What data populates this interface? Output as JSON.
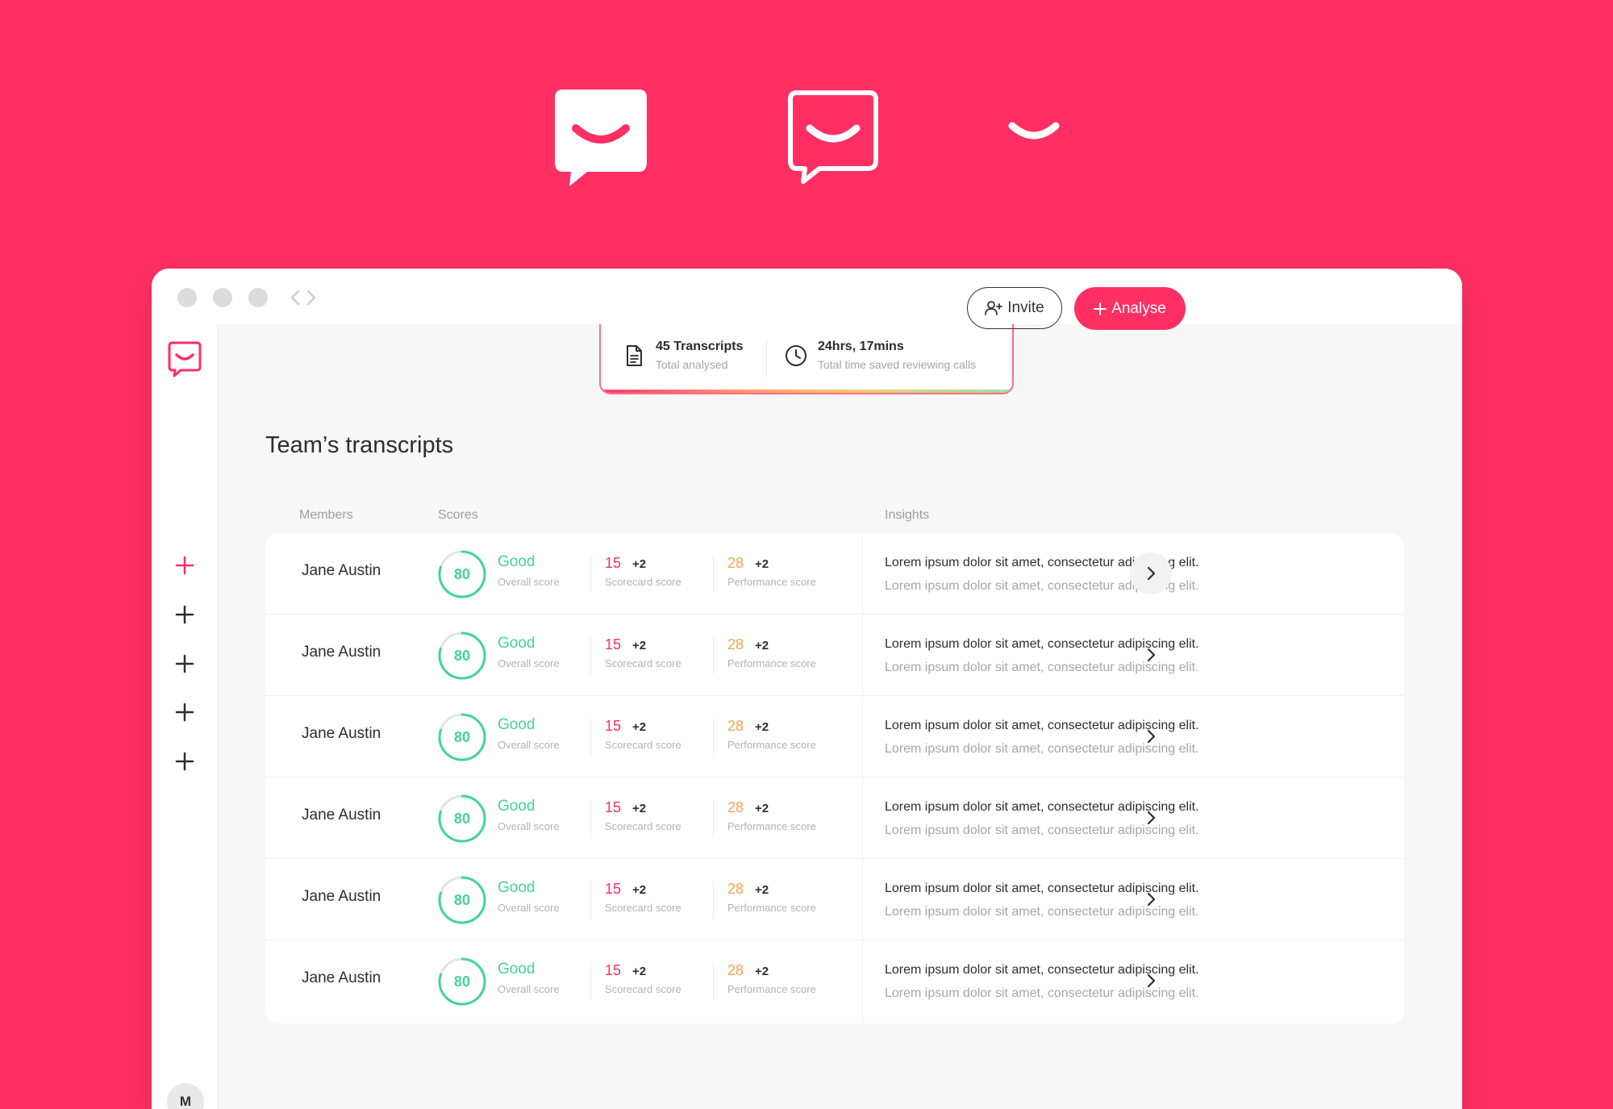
{
  "colors": {
    "brand": "#FF2F63",
    "good": "#43D49A",
    "orange": "#F7A34B",
    "text": "#2D2D2D",
    "muted": "#A6A6A6"
  },
  "logo_variations": [
    {
      "name": "filled-speech-bubble-logo"
    },
    {
      "name": "outline-speech-bubble-logo"
    },
    {
      "name": "smile-mark-logo"
    }
  ],
  "sidebar": {
    "items": [
      {
        "icon": "plus-icon",
        "active": true
      },
      {
        "icon": "plus-icon",
        "active": false
      },
      {
        "icon": "plus-icon",
        "active": false
      },
      {
        "icon": "plus-icon",
        "active": false
      },
      {
        "icon": "plus-icon",
        "active": false
      }
    ],
    "avatar_initial": "M"
  },
  "stats": {
    "transcripts": {
      "title": "45 Transcripts",
      "subtitle": "Total analysed",
      "icon": "document-icon"
    },
    "time_saved": {
      "title": "24hrs, 17mins",
      "subtitle": "Total time saved reviewing calls",
      "icon": "clock-icon"
    }
  },
  "actions": {
    "invite_label": "Invite",
    "analyse_label": "Analyse"
  },
  "page_title": "Team’s transcripts",
  "columns": {
    "members": "Members",
    "scores": "Scores",
    "insights": "Insights"
  },
  "rows": [
    {
      "member": "Jane Austin",
      "overall_value": "80",
      "overall_fraction": 0.8,
      "overall_label": "Good",
      "overall_sub": "Overall score",
      "scorecard_value": "15",
      "scorecard_delta": "+2",
      "scorecard_sub": "Scorecard score",
      "performance_value": "28",
      "performance_delta": "+2",
      "performance_sub": "Performance score",
      "insight_1": "Lorem ipsum dolor sit amet, consectetur adipiscing elit.",
      "insight_2": "Lorem ipsum dolor sit amet, consectetur adipiscing elit."
    },
    {
      "member": "Jane Austin",
      "overall_value": "80",
      "overall_fraction": 0.8,
      "overall_label": "Good",
      "overall_sub": "Overall score",
      "scorecard_value": "15",
      "scorecard_delta": "+2",
      "scorecard_sub": "Scorecard score",
      "performance_value": "28",
      "performance_delta": "+2",
      "performance_sub": "Performance score",
      "insight_1": "Lorem ipsum dolor sit amet, consectetur adipiscing elit.",
      "insight_2": "Lorem ipsum dolor sit amet, consectetur adipiscing elit."
    },
    {
      "member": "Jane Austin",
      "overall_value": "80",
      "overall_fraction": 0.8,
      "overall_label": "Good",
      "overall_sub": "Overall score",
      "scorecard_value": "15",
      "scorecard_delta": "+2",
      "scorecard_sub": "Scorecard score",
      "performance_value": "28",
      "performance_delta": "+2",
      "performance_sub": "Performance score",
      "insight_1": "Lorem ipsum dolor sit amet, consectetur adipiscing elit.",
      "insight_2": "Lorem ipsum dolor sit amet, consectetur adipiscing elit."
    },
    {
      "member": "Jane Austin",
      "overall_value": "80",
      "overall_fraction": 0.8,
      "overall_label": "Good",
      "overall_sub": "Overall score",
      "scorecard_value": "15",
      "scorecard_delta": "+2",
      "scorecard_sub": "Scorecard score",
      "performance_value": "28",
      "performance_delta": "+2",
      "performance_sub": "Performance score",
      "insight_1": "Lorem ipsum dolor sit amet, consectetur adipiscing elit.",
      "insight_2": "Lorem ipsum dolor sit amet, consectetur adipiscing elit."
    },
    {
      "member": "Jane Austin",
      "overall_value": "80",
      "overall_fraction": 0.8,
      "overall_label": "Good",
      "overall_sub": "Overall score",
      "scorecard_value": "15",
      "scorecard_delta": "+2",
      "scorecard_sub": "Scorecard score",
      "performance_value": "28",
      "performance_delta": "+2",
      "performance_sub": "Performance score",
      "insight_1": "Lorem ipsum dolor sit amet, consectetur adipiscing elit.",
      "insight_2": "Lorem ipsum dolor sit amet, consectetur adipiscing elit."
    },
    {
      "member": "Jane Austin",
      "overall_value": "80",
      "overall_fraction": 0.8,
      "overall_label": "Good",
      "overall_sub": "Overall score",
      "scorecard_value": "15",
      "scorecard_delta": "+2",
      "scorecard_sub": "Scorecard score",
      "performance_value": "28",
      "performance_delta": "+2",
      "performance_sub": "Performance score",
      "insight_1": "Lorem ipsum dolor sit amet, consectetur adipiscing elit.",
      "insight_2": "Lorem ipsum dolor sit amet, consectetur adipiscing elit."
    }
  ]
}
